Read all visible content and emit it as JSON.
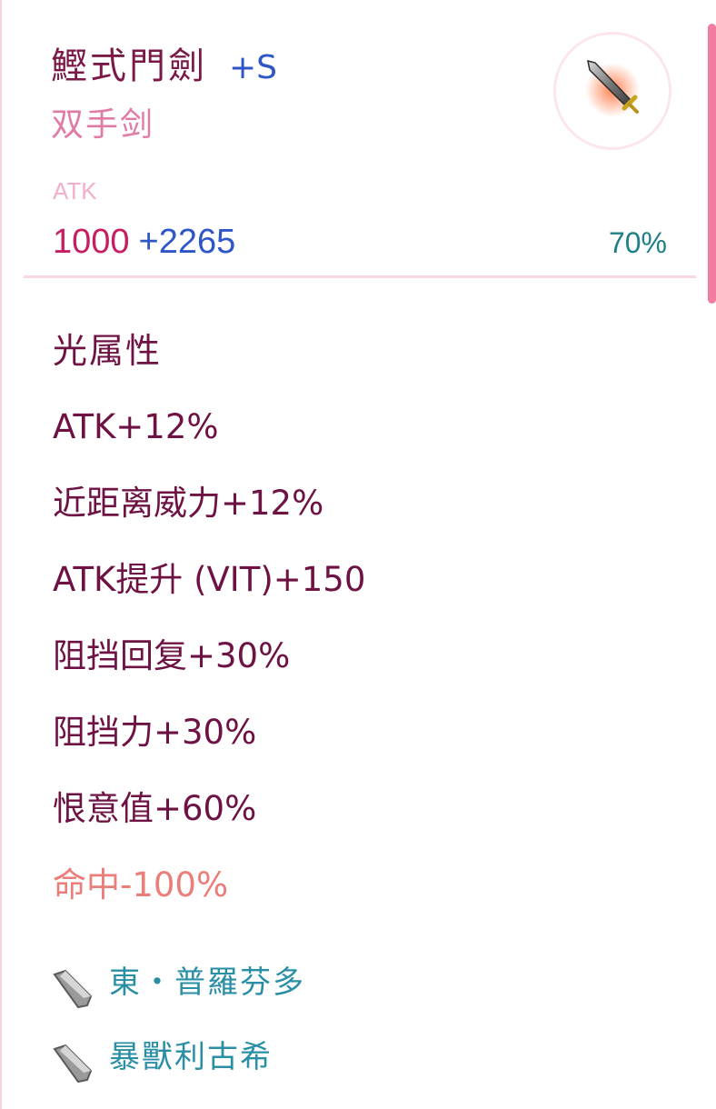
{
  "item": {
    "name": "鰹式門劍",
    "refine": "+S",
    "type": "双手剑",
    "icon": "two-handed-sword-icon"
  },
  "stats": {
    "label": "ATK",
    "base": "1000",
    "bonus": "+2265",
    "stability": "70%"
  },
  "attributes": [
    {
      "text": "光属性"
    },
    {
      "text": "ATK+12%"
    },
    {
      "text": "近距离威力+12%"
    },
    {
      "text": "ATK提升 (VIT)+150"
    },
    {
      "text": "阻挡回复+30%"
    },
    {
      "text": "阻挡力+30%"
    },
    {
      "text": "恨意值+60%"
    },
    {
      "text": "命中-100%"
    }
  ],
  "crystas": [
    {
      "name": "東・普羅芬多",
      "icon": "crysta-icon"
    },
    {
      "name": "暴獸利古希",
      "icon": "crysta-icon"
    }
  ],
  "colors": {
    "name": "#7a1947",
    "refine": "#2f56c7",
    "type": "#e27aa6",
    "atk_base": "#c51e63",
    "stability": "#1f7f87",
    "attribute": "#6e1244",
    "negative": "#ea7f79",
    "crysta": "#2a8fa5",
    "scrollbar": "#f27ba0"
  }
}
